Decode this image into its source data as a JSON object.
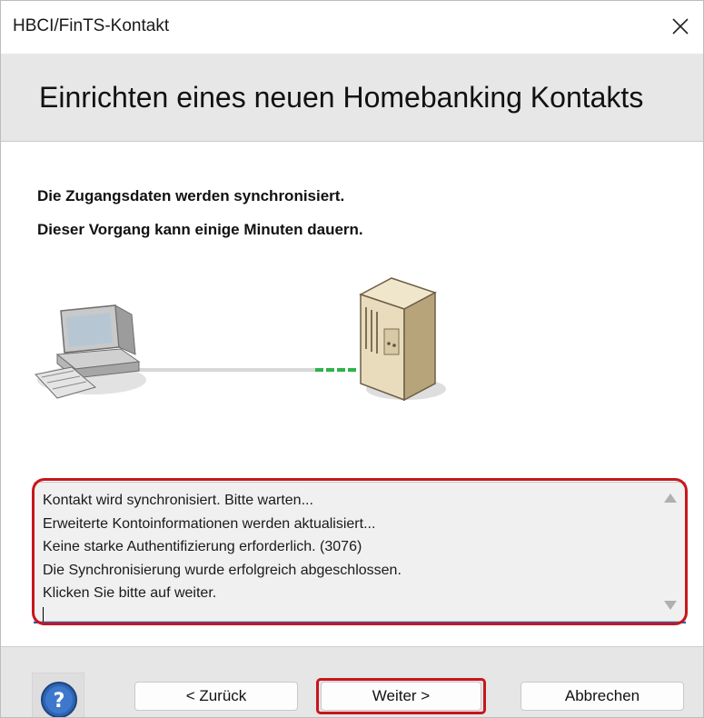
{
  "window": {
    "title": "HBCI/FinTS-Kontakt",
    "close_icon": "close-icon"
  },
  "header": {
    "title": "Einrichten eines neuen Homebanking Kontakts"
  },
  "content": {
    "info_line_1": "Die Zugangsdaten werden synchronisiert.",
    "info_line_2": "Dieser Vorgang kann einige Minuten dauern.",
    "illustration_icons": [
      "computer-icon",
      "server-icon"
    ],
    "log": [
      "Kontakt wird synchronisiert. Bitte warten...",
      "Erweiterte Kontoinformationen werden aktualisiert...",
      "Keine starke Authentifizierung erforderlich. (3076)",
      "Die Synchronisierung wurde erfolgreich abgeschlossen.",
      "Klicken Sie bitte auf weiter."
    ]
  },
  "footer": {
    "help_icon": "help-icon",
    "back_label": "< Zurück",
    "next_label": "Weiter >",
    "cancel_label": "Abbrechen"
  },
  "colors": {
    "highlight": "#c7161d",
    "header_band": "#e7e7e7",
    "footer_band": "#e6e6e6",
    "connection_active": "#2fb34a"
  }
}
